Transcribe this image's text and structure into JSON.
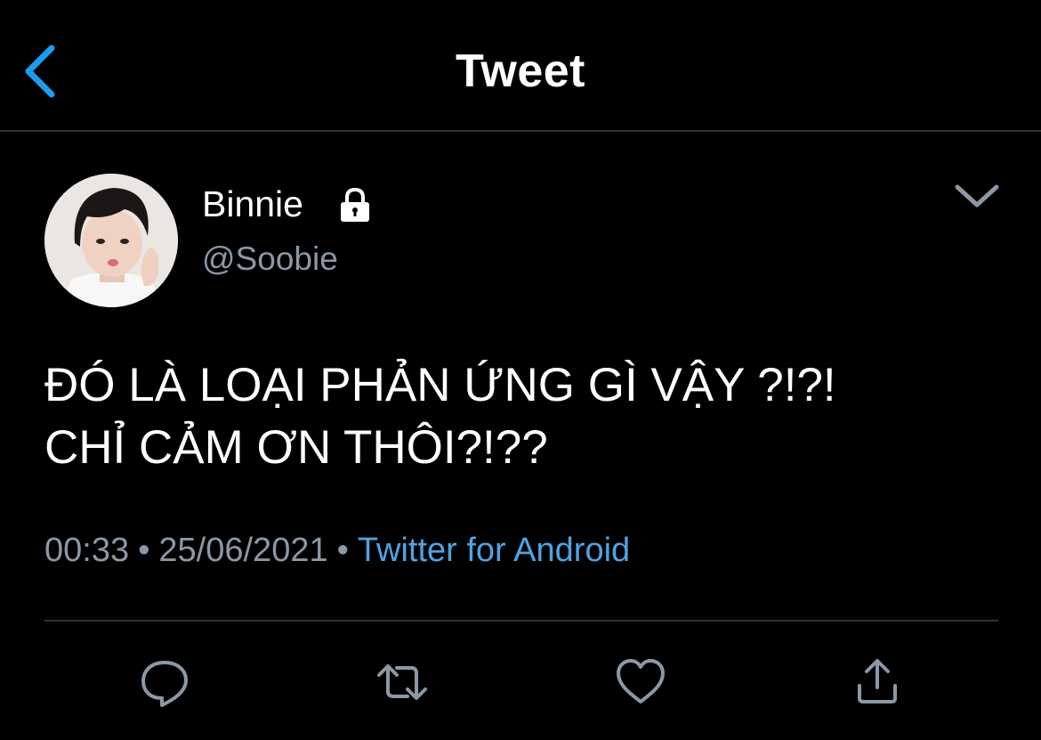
{
  "header": {
    "title": "Tweet",
    "back_icon": "chevron-left-icon"
  },
  "tweet": {
    "author": {
      "display_name": "Binnie",
      "handle": "@Soobie",
      "protected_icon": "lock-icon"
    },
    "text_lines": [
      "ĐÓ LÀ LOẠI PHẢN ỨNG GÌ VẬY ?!?!",
      "CHỈ CẢM ƠN THÔI?!??"
    ],
    "time": "00:33",
    "date": "25/06/2021",
    "separator": "•",
    "source": "Twitter for Android"
  },
  "actions": {
    "reply_icon": "reply-icon",
    "retweet_icon": "retweet-icon",
    "like_icon": "heart-icon",
    "share_icon": "share-icon"
  },
  "colors": {
    "background": "#000000",
    "accent": "#1d9bf0",
    "link": "#4fa3e3",
    "secondary_text": "#8b98a5",
    "divider": "#2f3336"
  }
}
